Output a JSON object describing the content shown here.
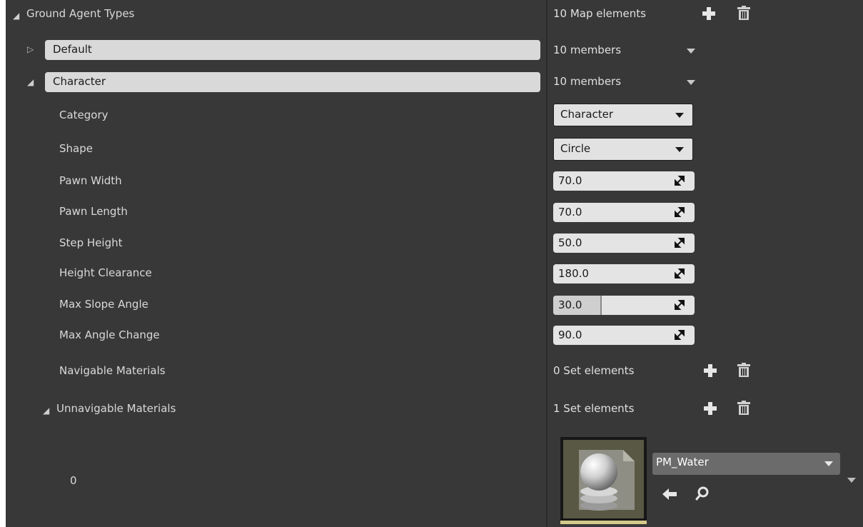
{
  "ground_agent_types": {
    "label": "Ground Agent Types",
    "value": "10 Map elements"
  },
  "entries": [
    {
      "name": "Default",
      "value": "10 members"
    },
    {
      "name": "Character",
      "value": "10 members"
    }
  ],
  "properties": {
    "category": {
      "label": "Category",
      "value": "Character"
    },
    "shape": {
      "label": "Shape",
      "value": "Circle"
    },
    "pawn_width": {
      "label": "Pawn Width",
      "value": "70.0"
    },
    "pawn_length": {
      "label": "Pawn Length",
      "value": "70.0"
    },
    "step_height": {
      "label": "Step Height",
      "value": "50.0"
    },
    "height_clearance": {
      "label": "Height Clearance",
      "value": "180.0"
    },
    "max_slope_angle": {
      "label": "Max Slope Angle",
      "value": "30.0",
      "slider_fraction": 0.3333
    },
    "max_angle_change": {
      "label": "Max Angle Change",
      "value": "90.0"
    },
    "navigable_materials": {
      "label": "Navigable Materials",
      "value": "0 Set elements"
    },
    "unnavigable_materials": {
      "label": "Unnavigable Materials",
      "value": "1 Set elements"
    }
  },
  "set_element": {
    "index": "0",
    "asset_name": "PM_Water"
  },
  "icons": [
    "expand-triangle-icon",
    "collapse-triangle-icon",
    "plus-icon",
    "trash-icon",
    "chevron-down-icon",
    "resize-icon",
    "arrow-left-icon",
    "search-icon"
  ],
  "colors": {
    "panel": "#383838",
    "field": "#e2e2e2",
    "text": "#dcdcdc",
    "asset_bar": "#6b6b6b"
  }
}
